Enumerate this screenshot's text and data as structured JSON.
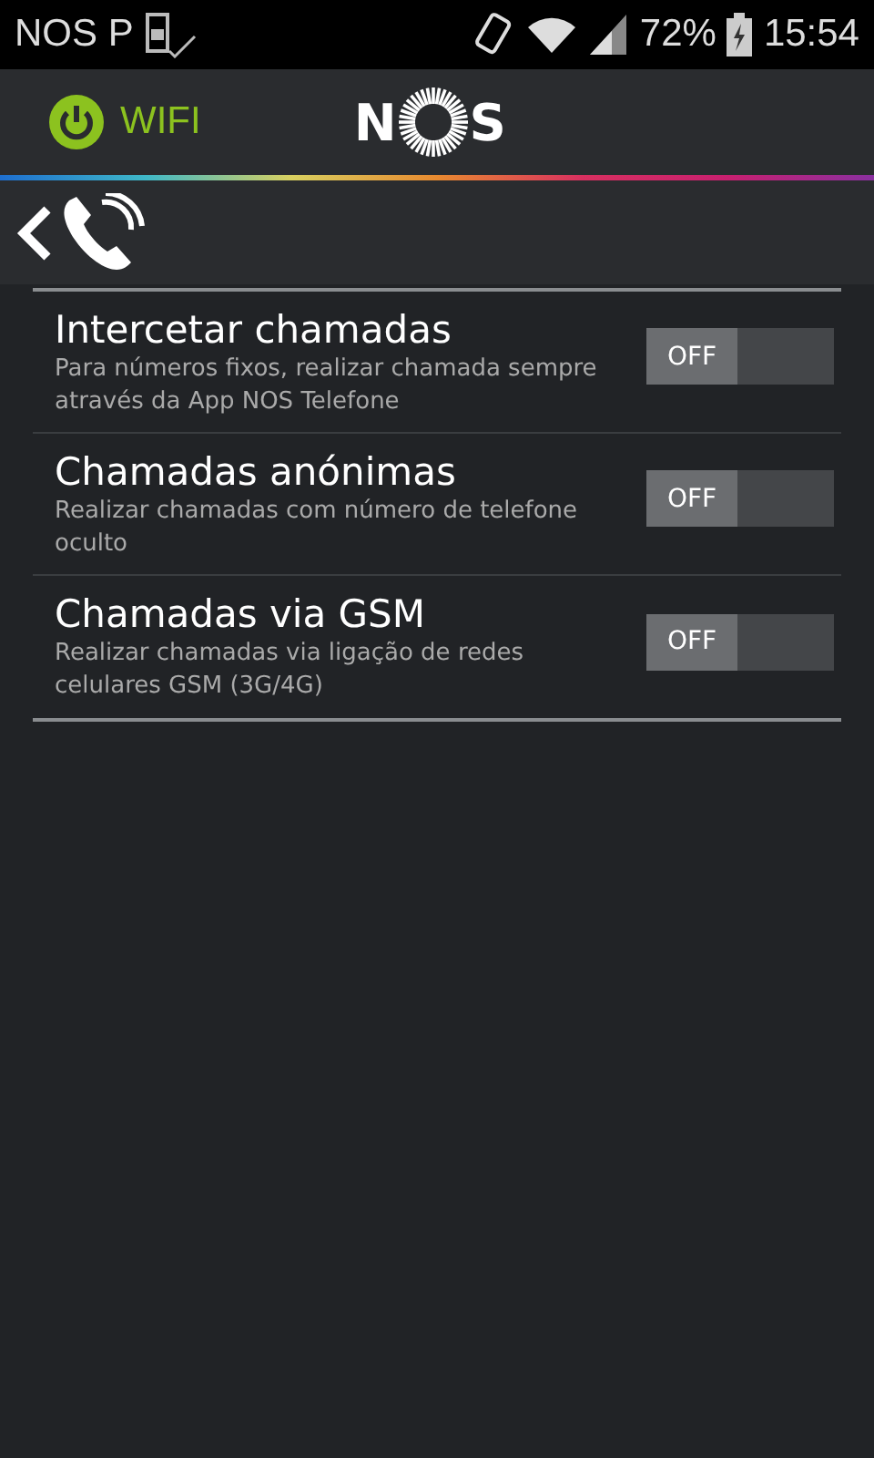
{
  "status_bar": {
    "carrier": "NOS P",
    "battery": "72%",
    "time": "15:54"
  },
  "header": {
    "wifi_label": "WIFI",
    "logo": {
      "left": "N",
      "right": "S"
    }
  },
  "settings": [
    {
      "title": "Intercetar chamadas",
      "description": "Para números fixos, realizar chamada sempre através da App NOS Telefone",
      "toggle": {
        "on": false,
        "label": "OFF"
      }
    },
    {
      "title": "Chamadas anónimas",
      "description": "Realizar chamadas com número de telefone oculto",
      "toggle": {
        "on": false,
        "label": "OFF"
      }
    },
    {
      "title": "Chamadas via GSM",
      "description": "Realizar chamadas via ligação de redes celulares GSM (3G/4G)",
      "toggle": {
        "on": false,
        "label": "OFF"
      }
    }
  ]
}
